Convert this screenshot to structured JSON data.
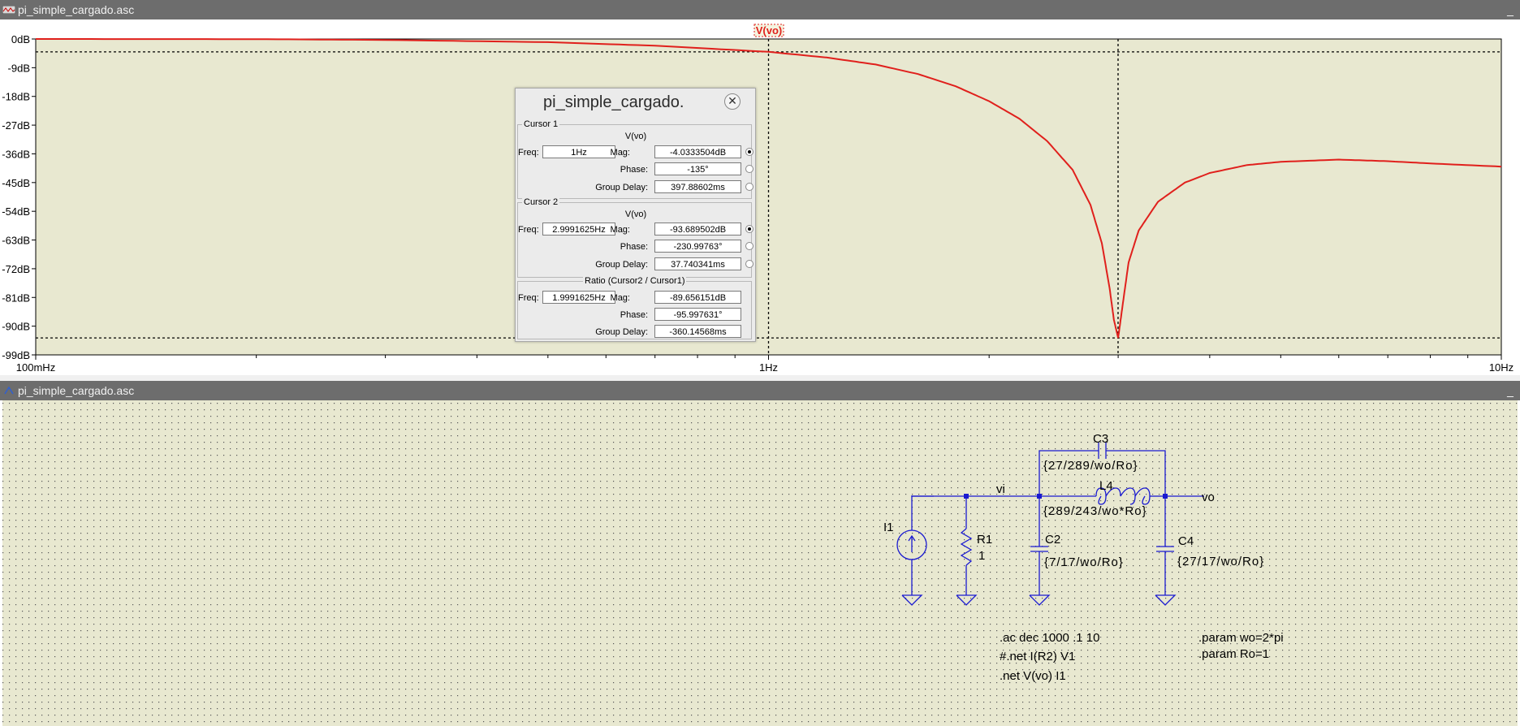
{
  "plot_window": {
    "title": "pi_simple_cargado.asc",
    "trace_label": "V(vo)",
    "colors": {
      "background": "#e8e8d0",
      "trace": "#e0201c",
      "axis": "#000000"
    }
  },
  "chart_data": {
    "type": "line",
    "title": "",
    "xlabel": "",
    "ylabel": "",
    "x_scale": "log",
    "xlim": [
      0.1,
      10
    ],
    "ylim": [
      -99,
      0
    ],
    "x_ticks": [
      "100mHz",
      "1Hz",
      "10Hz"
    ],
    "y_ticks": [
      "0dB",
      "-9dB",
      "-18dB",
      "-27dB",
      "-36dB",
      "-45dB",
      "-54dB",
      "-63dB",
      "-72dB",
      "-81dB",
      "-90dB",
      "-99dB"
    ],
    "series": [
      {
        "name": "V(vo)",
        "points": [
          [
            0.1,
            0.0
          ],
          [
            0.2,
            -0.05
          ],
          [
            0.3,
            -0.3
          ],
          [
            0.5,
            -1.0
          ],
          [
            0.7,
            -2.1
          ],
          [
            1.0,
            -4.03
          ],
          [
            1.2,
            -5.8
          ],
          [
            1.4,
            -8.0
          ],
          [
            1.6,
            -11.0
          ],
          [
            1.8,
            -14.8
          ],
          [
            2.0,
            -19.5
          ],
          [
            2.2,
            -25.0
          ],
          [
            2.4,
            -32.0
          ],
          [
            2.6,
            -41.0
          ],
          [
            2.75,
            -52.0
          ],
          [
            2.85,
            -64.0
          ],
          [
            2.92,
            -78.0
          ],
          [
            2.96,
            -88.0
          ],
          [
            3.0,
            -93.69
          ],
          [
            3.04,
            -84.0
          ],
          [
            3.1,
            -70.0
          ],
          [
            3.2,
            -60.0
          ],
          [
            3.4,
            -51.0
          ],
          [
            3.7,
            -45.0
          ],
          [
            4.0,
            -42.0
          ],
          [
            4.5,
            -39.5
          ],
          [
            5.0,
            -38.5
          ],
          [
            6.0,
            -37.8
          ],
          [
            7.0,
            -38.3
          ],
          [
            8.0,
            -39.0
          ],
          [
            10.0,
            -40.0
          ]
        ]
      }
    ],
    "cursors": [
      {
        "name": "Cursor 1",
        "freq": 1.0,
        "mag_db": -4.0333504
      },
      {
        "name": "Cursor 2",
        "freq": 2.9991625,
        "mag_db": -93.689502
      }
    ],
    "grid": false
  },
  "cursor_dialog": {
    "title": "pi_simple_cargado.",
    "cursor1": {
      "legend": "Cursor 1",
      "trace": "V(vo)",
      "freq_label": "Freq:",
      "freq": "1Hz",
      "mag_label": "Mag:",
      "mag": "-4.0333504dB",
      "phase_label": "Phase:",
      "phase": "-135°",
      "gd_label": "Group Delay:",
      "group_delay": "397.88602ms"
    },
    "cursor2": {
      "legend": "Cursor 2",
      "trace": "V(vo)",
      "freq_label": "Freq:",
      "freq": "2.9991625Hz",
      "mag_label": "Mag:",
      "mag": "-93.689502dB",
      "phase_label": "Phase:",
      "phase": "-230.99763°",
      "gd_label": "Group Delay:",
      "group_delay": "37.740341ms"
    },
    "ratio": {
      "legend": "Ratio (Cursor2 / Cursor1)",
      "freq_label": "Freq:",
      "freq": "1.9991625Hz",
      "mag_label": "Mag:",
      "mag": "-89.656151dB",
      "phase_label": "Phase:",
      "phase": "-95.997631°",
      "gd_label": "Group Delay:",
      "group_delay": "-360.14568ms"
    }
  },
  "schematic_window": {
    "title": "pi_simple_cargado.asc",
    "colors": {
      "background": "#e8e8d0",
      "wire": "#1a1ad0",
      "text": "#000000"
    },
    "components": {
      "I1": {
        "name": "I1"
      },
      "R1": {
        "name": "R1",
        "value": "1"
      },
      "C2": {
        "name": "C2",
        "value": "{7/17/wo/Ro}"
      },
      "C3": {
        "name": "C3",
        "value": "{27/289/wo/Ro}"
      },
      "L4": {
        "name": "L4",
        "value": "{289/243/wo*Ro}"
      },
      "C4": {
        "name": "C4",
        "value": "{27/17/wo/Ro}"
      }
    },
    "nets": {
      "vi": "vi",
      "vo": "vo"
    },
    "directives": {
      "ac": ".ac dec 1000 .1 10",
      "net1": "#.net I(R2) V1",
      "net2": ".net V(vo) I1",
      "param1": ".param wo=2*pi",
      "param2": ".param Ro=1"
    }
  }
}
